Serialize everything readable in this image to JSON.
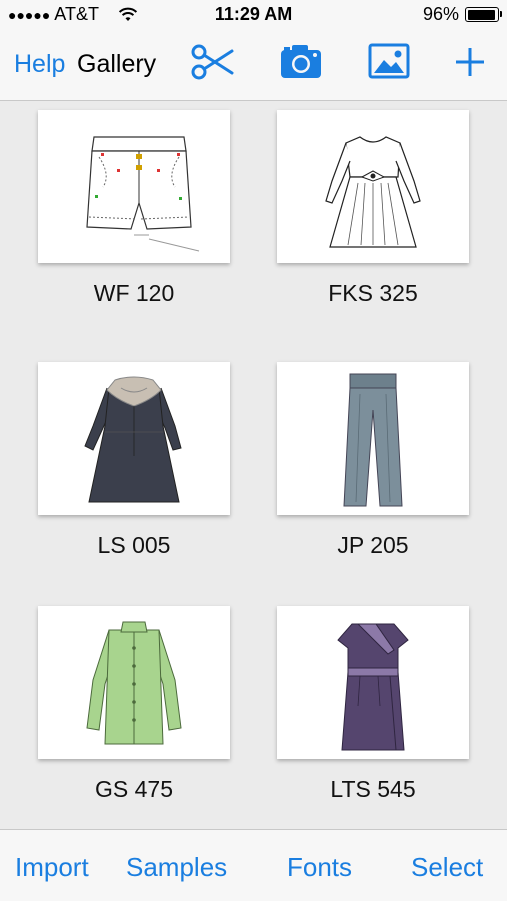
{
  "status": {
    "carrier": "AT&T",
    "time": "11:29 AM",
    "battery": "96%",
    "battery_level": 0.96
  },
  "nav": {
    "help_label": "Help",
    "title": "Gallery",
    "icons": [
      "scissors-icon",
      "camera-icon",
      "image-icon",
      "plus-icon"
    ]
  },
  "gallery": {
    "items": [
      {
        "label": "WF 120",
        "garment": "shorts"
      },
      {
        "label": "FKS 325",
        "garment": "dress"
      },
      {
        "label": "LS 005",
        "garment": "dark-dress"
      },
      {
        "label": "JP 205",
        "garment": "pants"
      },
      {
        "label": "GS 475",
        "garment": "shirt"
      },
      {
        "label": "LTS 545",
        "garment": "wrap-dress"
      }
    ]
  },
  "toolbar": {
    "import_label": "Import",
    "samples_label": "Samples",
    "fonts_label": "Fonts",
    "select_label": "Select"
  },
  "colors": {
    "accent": "#1a7ee0",
    "background": "#ebebeb",
    "bar": "#f7f7f7"
  }
}
